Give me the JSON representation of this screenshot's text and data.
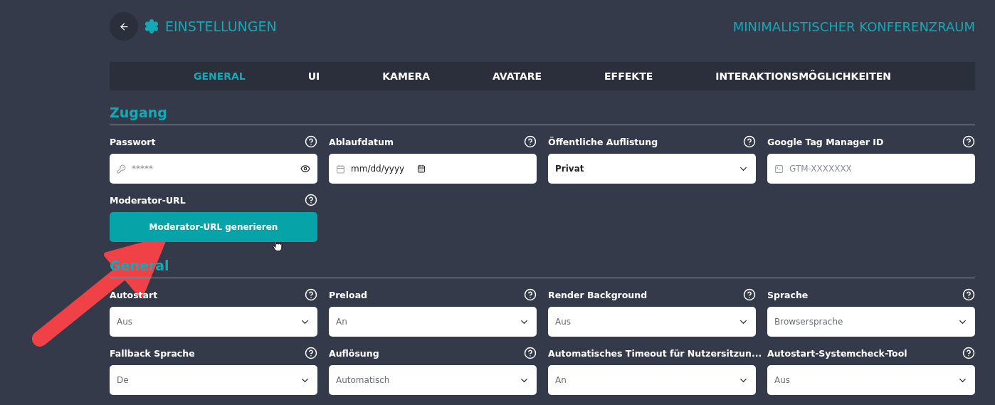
{
  "header": {
    "title": "EINSTELLUNGEN",
    "room": "MINIMALISTISCHER KONFERENZRAUM"
  },
  "tabs": [
    {
      "label": "GENERAL",
      "selected": true
    },
    {
      "label": "UI",
      "selected": false
    },
    {
      "label": "KAMERA",
      "selected": false
    },
    {
      "label": "AVATARE",
      "selected": false
    },
    {
      "label": "EFFEKTE",
      "selected": false
    },
    {
      "label": "INTERAKTIONSMÖGLICHKEITEN",
      "selected": false
    }
  ],
  "sections": [
    {
      "title": "Zugang",
      "fields": [
        {
          "label": "Passwort",
          "kind": "password",
          "value": "*****"
        },
        {
          "label": "Ablaufdatum",
          "kind": "date",
          "value": "mm/dd/yyyy"
        },
        {
          "label": "Öffentliche Auflistung",
          "kind": "select",
          "value": "Privat",
          "dimmed": false
        },
        {
          "label": "Google Tag Manager ID",
          "kind": "text",
          "placeholder": "GTM-XXXXXXX"
        },
        {
          "label": "Moderator-URL",
          "kind": "button",
          "button": "Moderator-URL generieren"
        }
      ]
    },
    {
      "title": "General",
      "fields": [
        {
          "label": "Autostart",
          "kind": "select",
          "value": "Aus",
          "dimmed": true
        },
        {
          "label": "Preload",
          "kind": "select",
          "value": "An",
          "dimmed": true
        },
        {
          "label": "Render Background",
          "kind": "select",
          "value": "Aus",
          "dimmed": true
        },
        {
          "label": "Sprache",
          "kind": "select",
          "value": "Browsersprache",
          "dimmed": true
        },
        {
          "label": "Fallback Sprache",
          "kind": "select",
          "value": "De",
          "dimmed": true
        },
        {
          "label": "Auflösung",
          "kind": "select",
          "value": "Automatisch",
          "dimmed": true
        },
        {
          "label": "Automatisches Timeout für Nutzersitzun...",
          "kind": "select",
          "value": "An",
          "dimmed": true
        },
        {
          "label": "Autostart-Systemcheck-Tool",
          "kind": "select",
          "value": "Aus",
          "dimmed": true
        }
      ]
    }
  ]
}
